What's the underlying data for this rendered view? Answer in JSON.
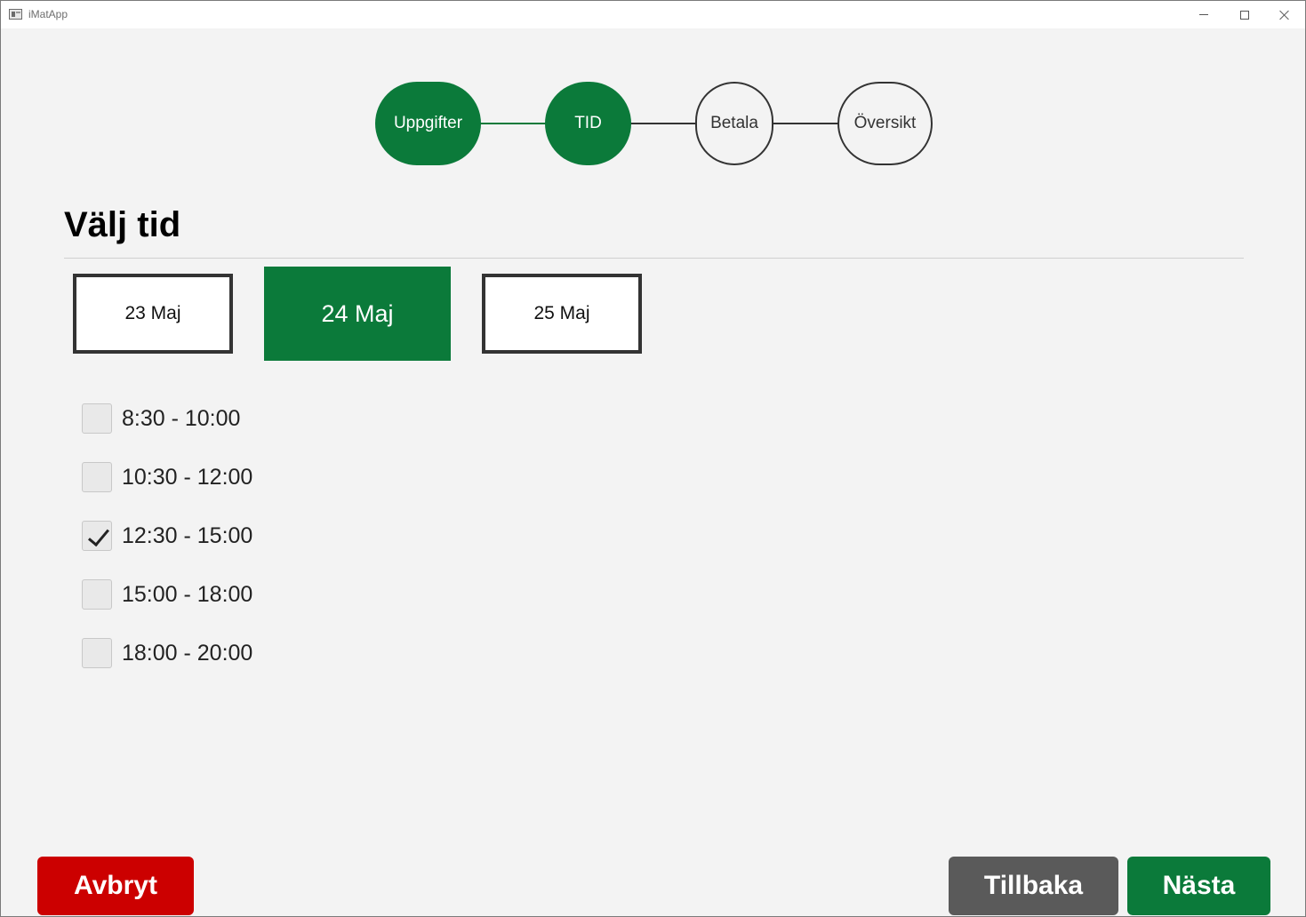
{
  "window": {
    "title": "iMatApp"
  },
  "steps": [
    {
      "label": "Uppgifter",
      "state": "done"
    },
    {
      "label": "TID",
      "state": "done"
    },
    {
      "label": "Betala",
      "state": "todo"
    },
    {
      "label": "Översikt",
      "state": "todo"
    }
  ],
  "page": {
    "title": "Välj tid"
  },
  "dates": [
    {
      "label": "23 Maj",
      "selected": false
    },
    {
      "label": "24 Maj",
      "selected": true
    },
    {
      "label": "25 Maj",
      "selected": false
    }
  ],
  "time_slots": [
    {
      "label": "8:30 - 10:00",
      "checked": false
    },
    {
      "label": "10:30 - 12:00",
      "checked": false
    },
    {
      "label": "12:30 - 15:00",
      "checked": true
    },
    {
      "label": "15:00 - 18:00",
      "checked": false
    },
    {
      "label": "18:00 - 20:00",
      "checked": false
    }
  ],
  "buttons": {
    "cancel": "Avbryt",
    "back": "Tillbaka",
    "next": "Nästa"
  },
  "colors": {
    "accent_green": "#0b7a3a",
    "cancel_red": "#cc0000",
    "back_gray": "#5a5a5a"
  }
}
